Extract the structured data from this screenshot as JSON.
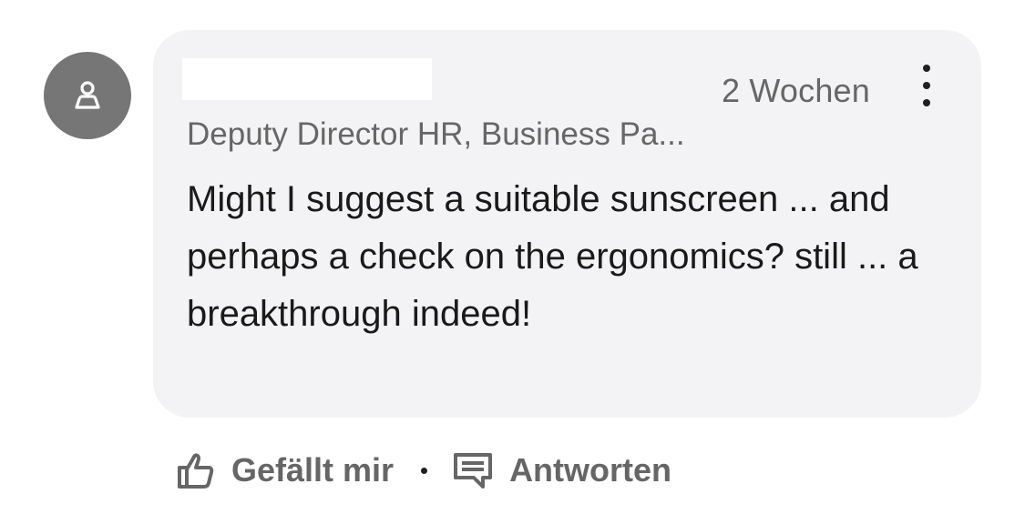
{
  "comment": {
    "timestamp": "2 Wochen",
    "author_headline": "Deputy Director HR, Business Pa...",
    "text": "Might I suggest a suitable sunscreen ... and perhaps a check on the ergonomics? still ... a breakthrough indeed!"
  },
  "actions": {
    "like_label": "Gefällt mir",
    "reply_label": "Antworten"
  },
  "icons": {
    "avatar": "person-icon",
    "more": "more-vertical-icon",
    "like": "thumbs-up-icon",
    "reply": "comment-icon"
  },
  "colors": {
    "bubble_background": "#f3f3f5",
    "avatar_background": "#767676",
    "secondary_text": "#666666",
    "primary_text": "#1a1a1a"
  }
}
